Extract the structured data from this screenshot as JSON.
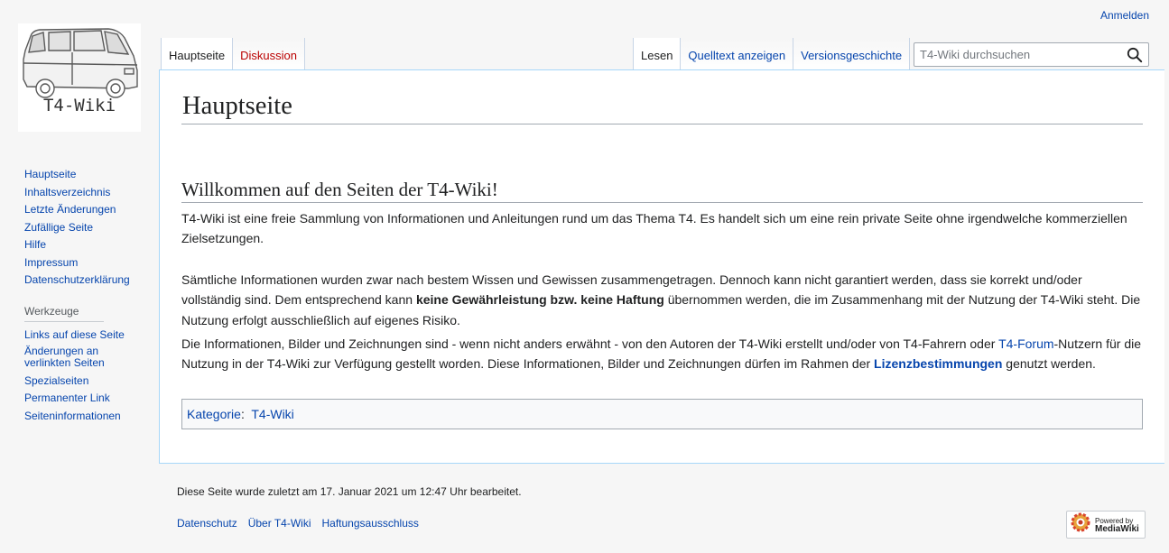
{
  "site": {
    "logo_text": "T4-Wiki"
  },
  "personal": {
    "login": "Anmelden"
  },
  "sidebar": {
    "navigation": [
      {
        "label": "Hauptseite"
      },
      {
        "label": "Inhaltsverzeichnis"
      },
      {
        "label": "Letzte Änderungen"
      },
      {
        "label": "Zufällige Seite"
      },
      {
        "label": "Hilfe"
      },
      {
        "label": "Impressum"
      },
      {
        "label": "Datenschutzerklärung"
      }
    ],
    "tools_heading": "Werkzeuge",
    "tools": [
      {
        "label": "Links auf diese Seite"
      },
      {
        "label": "Änderungen an verlinkten Seiten"
      },
      {
        "label": "Spezialseiten"
      },
      {
        "label": "Permanenter Link"
      },
      {
        "label": "Seiteninformationen"
      }
    ]
  },
  "tabs": {
    "page": "Hauptseite",
    "discussion": "Diskussion",
    "read": "Lesen",
    "view_source": "Quelltext anzeigen",
    "history": "Versionsgeschichte"
  },
  "search": {
    "placeholder": "T4-Wiki durchsuchen",
    "value": ""
  },
  "content": {
    "title": "Hauptseite",
    "section_title": "Willkommen auf den Seiten der T4-Wiki!",
    "p1": "T4-Wiki ist eine freie Sammlung von Informationen und Anleitungen rund um das Thema T4. Es handelt sich um eine rein private Seite ohne irgendwelche kommerziellen Zielsetzungen.",
    "p2_a": "Sämtliche Informationen wurden zwar nach bestem Wissen und Gewissen zusammengetragen. Dennoch kann nicht garantiert werden, dass sie korrekt und/oder vollständig sind. Dem entsprechend kann ",
    "p2_bold": "keine Gewährleistung bzw. keine Haftung",
    "p2_b": " übernommen werden, die im Zusammenhang mit der Nutzung der T4-Wiki steht. Die Nutzung erfolgt ausschließlich auf eigenes Risiko.",
    "p3_a": "Die Informationen, Bilder und Zeichnungen sind - wenn nicht anders erwähnt - von den Autoren der T4-Wiki erstellt und/oder von T4-Fahrern oder ",
    "p3_link1": "T4-Forum",
    "p3_b": "-Nutzern für die Nutzung in der T4-Wiki zur Verfügung gestellt worden. Diese Informationen, Bilder und Zeichnungen dürfen im Rahmen der ",
    "p3_link2": "Lizenzbestimmungen",
    "p3_c": " genutzt werden.",
    "category_label": "Kategorie",
    "category_sep": ":",
    "category_value": "T4-Wiki"
  },
  "footer": {
    "last_modified": "Diese Seite wurde zuletzt am 17. Januar 2021 um 12:47 Uhr bearbeitet.",
    "links": [
      "Datenschutz",
      "Über T4-Wiki",
      "Haftungsausschluss"
    ],
    "powered_line1": "Powered by",
    "powered_line2": "MediaWiki"
  },
  "colors": {
    "link": "#0645ad",
    "new_link": "#ba0000",
    "tab_border": "#a7d7f9",
    "background": "#f6f6f6"
  }
}
